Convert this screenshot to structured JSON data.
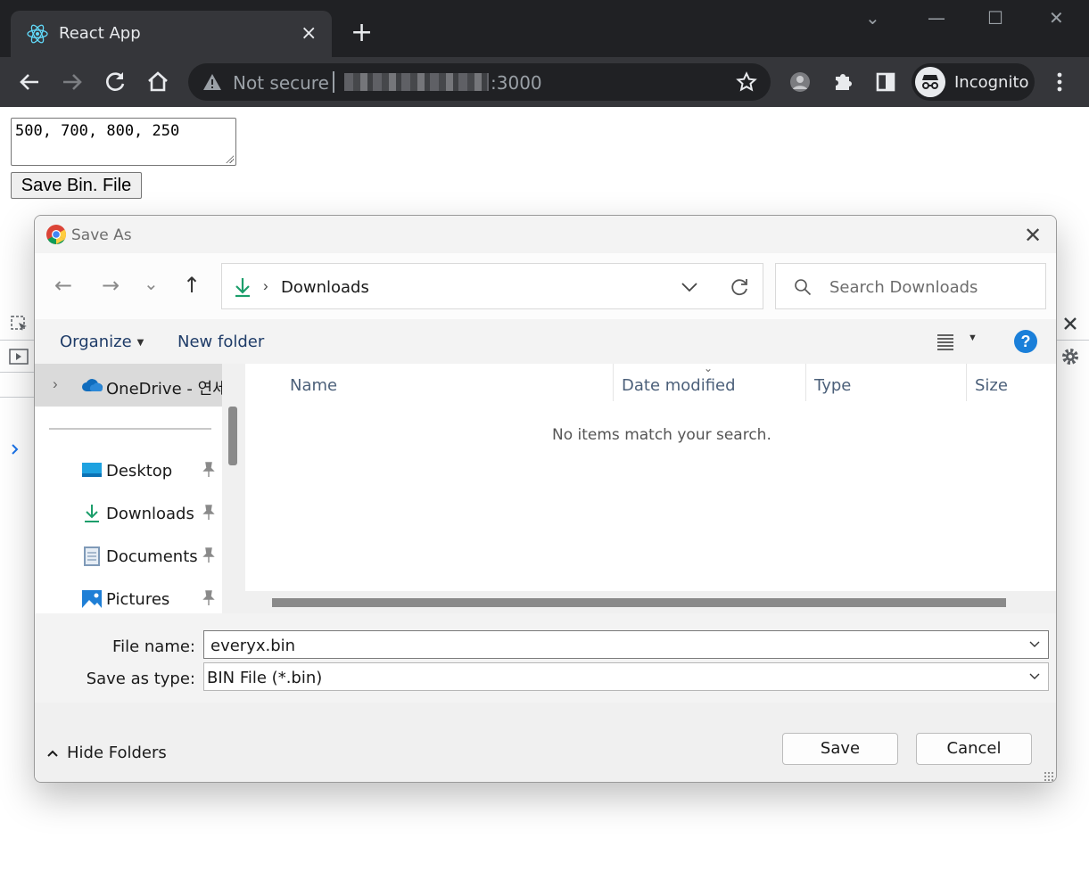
{
  "browser": {
    "tab_title": "React App",
    "tab_close": "×",
    "new_tab": "+",
    "not_secure": "Not secure",
    "url_port": ":3000",
    "profile_label": "Incognito",
    "window_controls": [
      "⌄",
      "—",
      "☐",
      "✕"
    ]
  },
  "page": {
    "textarea_value": "500, 700, 800, 250",
    "save_button_label": "Save Bin. File"
  },
  "dialog": {
    "title": "Save As",
    "close": "✕",
    "nav_back": "←",
    "nav_forward": "→",
    "nav_recent": "⌄",
    "nav_up": "↑",
    "address": {
      "separator": "›",
      "location": "Downloads"
    },
    "search_placeholder": "Search Downloads",
    "commands": {
      "organize": "Organize",
      "new_folder": "New folder",
      "help": "?"
    },
    "nav_pane": [
      {
        "label": "OneDrive - 연세",
        "icon": "cloud-icon"
      },
      {
        "label": "Desktop",
        "icon": "desktop-icon"
      },
      {
        "label": "Downloads",
        "icon": "download-icon"
      },
      {
        "label": "Documents",
        "icon": "document-icon"
      },
      {
        "label": "Pictures",
        "icon": "pictures-icon"
      }
    ],
    "columns": [
      "Name",
      "Date modified",
      "Type",
      "Size"
    ],
    "empty_message": "No items match your search.",
    "file_name_label": "File name:",
    "file_name_value": "everyx.bin",
    "save_type_label": "Save as type:",
    "save_type_value": "BIN File (*.bin)",
    "hide_folders": "Hide Folders",
    "save_button": "Save",
    "cancel_button": "Cancel"
  },
  "colors": {
    "chrome_dark": "#202124",
    "chrome_toolbar": "#35363a",
    "dialog_bg": "#f3f3f3",
    "accent_blue": "#1a7fd9",
    "download_green": "#1c9e6b"
  }
}
